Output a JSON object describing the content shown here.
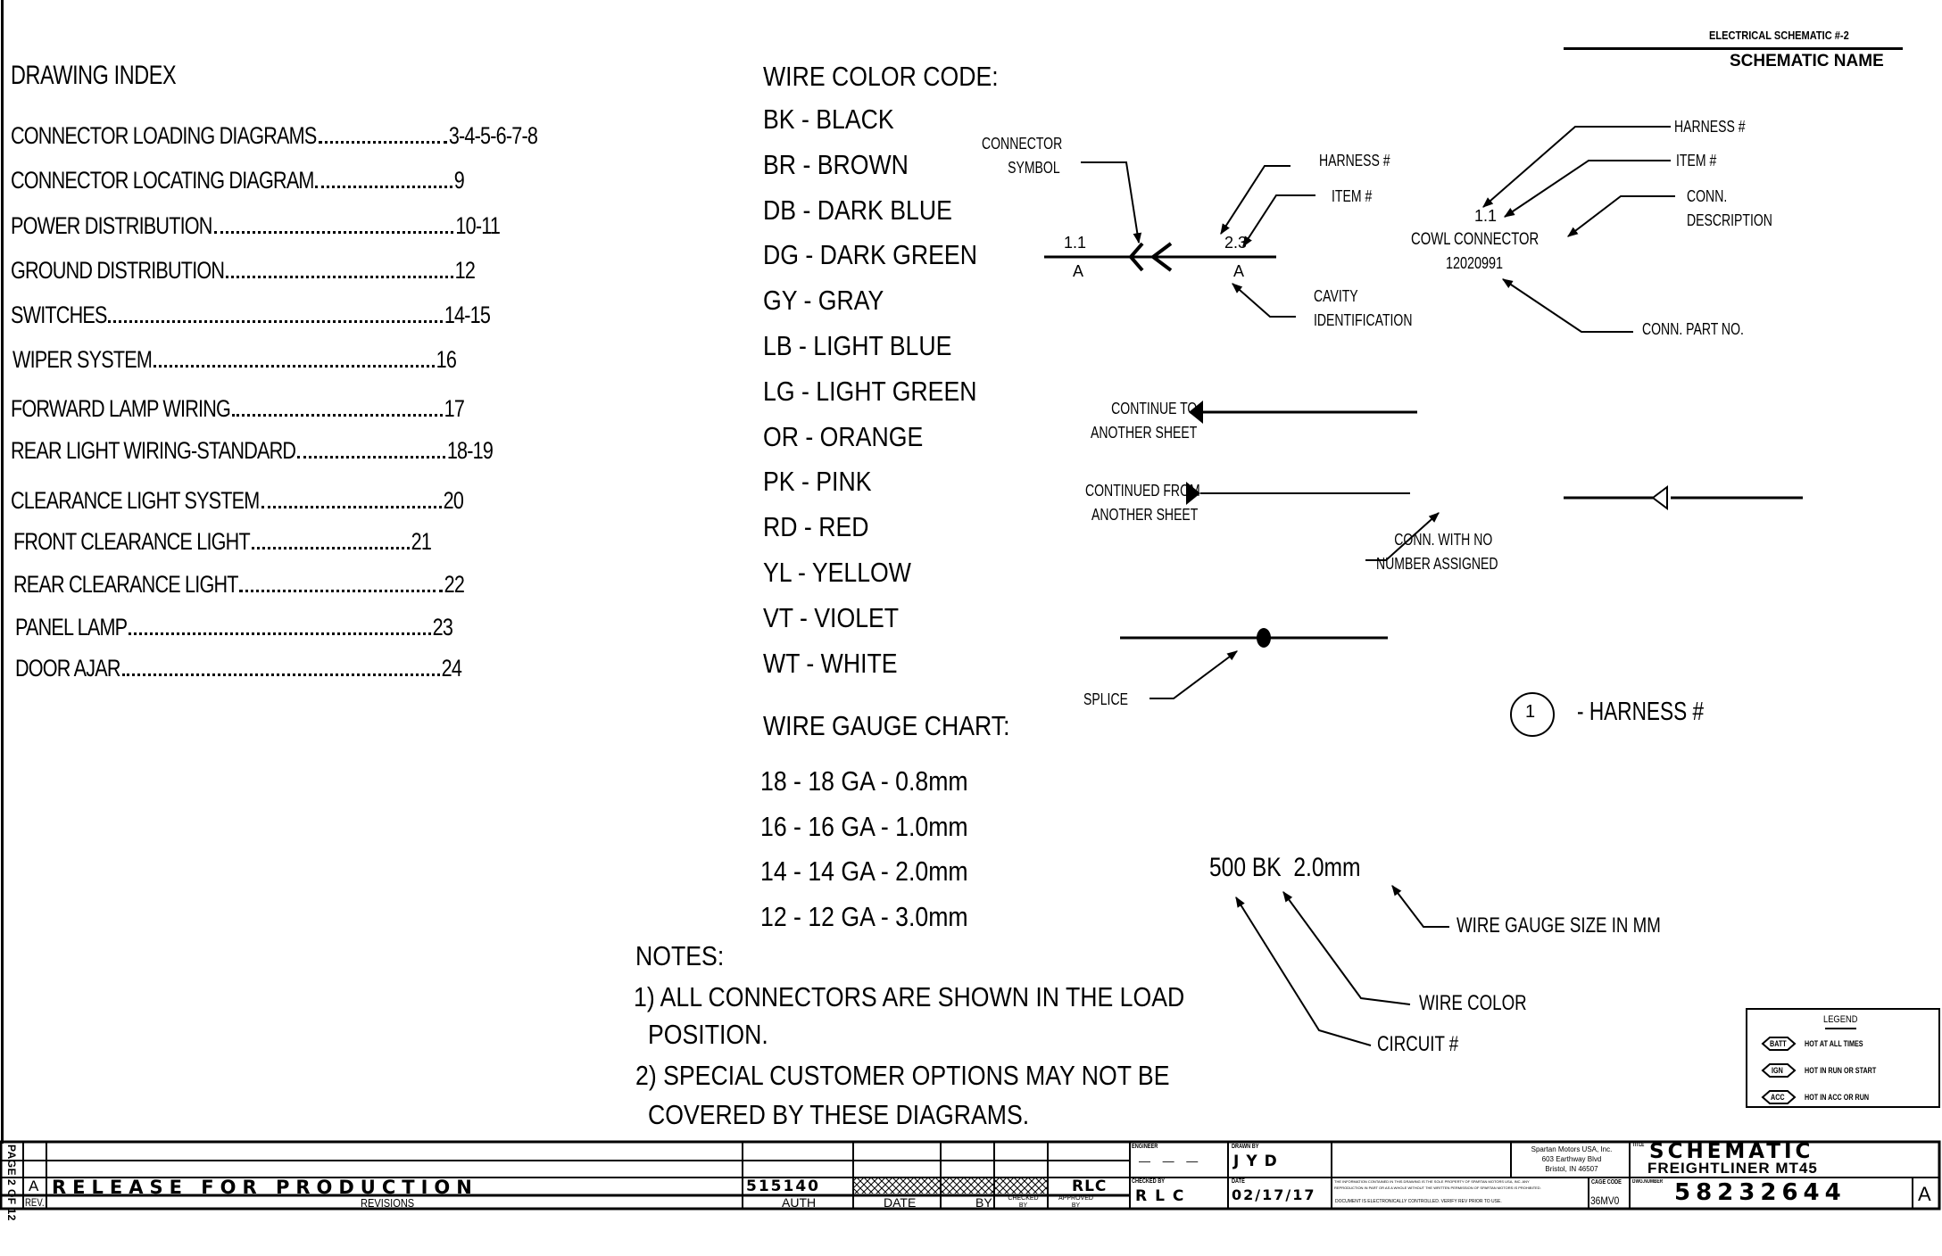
{
  "header": {
    "sheet_label": "ELECTRICAL SCHEMATIC #-2",
    "schematic_name": "SCHEMATIC NAME"
  },
  "drawing_index": {
    "title": "DRAWING INDEX",
    "items": [
      {
        "label": "CONNECTOR LOADING DIAGRAMS",
        "pages": "3-4-5-6-7-8"
      },
      {
        "label": "CONNECTOR LOCATING DIAGRAM",
        "pages": "9"
      },
      {
        "label": "POWER DISTRIBUTION",
        "pages": "10-11"
      },
      {
        "label": "GROUND DISTRIBUTION",
        "pages": "12"
      },
      {
        "label": "SWITCHES",
        "pages": "14-15"
      },
      {
        "label": "WIPER SYSTEM",
        "pages": "16"
      },
      {
        "label": "FORWARD LAMP WIRING",
        "pages": "17"
      },
      {
        "label": "REAR LIGHT WIRING-STANDARD",
        "pages": "18-19"
      },
      {
        "label": "CLEARANCE LIGHT SYSTEM",
        "pages": "20"
      },
      {
        "label": "FRONT CLEARANCE LIGHT",
        "pages": "21"
      },
      {
        "label": "REAR CLEARANCE LIGHT",
        "pages": "22"
      },
      {
        "label": "PANEL LAMP",
        "pages": "23"
      },
      {
        "label": "DOOR AJAR",
        "pages": "24"
      }
    ]
  },
  "wire_color_code": {
    "title": "WIRE COLOR CODE:",
    "items": [
      "BK - BLACK",
      "BR - BROWN",
      "DB - DARK BLUE",
      "DG - DARK GREEN",
      "GY - GRAY",
      "LB - LIGHT BLUE",
      "LG - LIGHT GREEN",
      "OR - ORANGE",
      "PK - PINK",
      "RD - RED",
      "YL - YELLOW",
      "VT - VIOLET",
      "WT - WHITE"
    ]
  },
  "wire_gauge_chart": {
    "title": "WIRE GAUGE CHART:",
    "items": [
      "18 - 18 GA - 0.8mm",
      "16 - 16 GA - 1.0mm",
      "14 - 14 GA - 2.0mm",
      "12 - 12 GA - 3.0mm"
    ]
  },
  "notes": {
    "title": "NOTES:",
    "items": [
      {
        "line1": "1) ALL CONNECTORS ARE SHOWN IN THE LOAD",
        "line2": "POSITION."
      },
      {
        "line1": "2) SPECIAL CUSTOMER OPTIONS MAY NOT BE",
        "line2": "COVERED BY THESE DIAGRAMS."
      }
    ]
  },
  "connector_example": {
    "symbol_label_1": "CONNECTOR",
    "symbol_label_2": "SYMBOL",
    "left_harness_item": "1.1",
    "left_cavity": "A",
    "right_harness_item": "2.3",
    "right_cavity": "A",
    "harness_label": "HARNESS #",
    "item_label": "ITEM #",
    "cavity_label_1": "CAVITY",
    "cavity_label_2": "IDENTIFICATION"
  },
  "cowl_example": {
    "harness_item": "1.1",
    "description": "COWL CONNECTOR",
    "part_no": "12020991",
    "harness_label": "HARNESS #",
    "item_label": "ITEM #",
    "desc_label_1": "CONN.",
    "desc_label_2": "DESCRIPTION",
    "part_label": "CONN. PART NO."
  },
  "symbols": {
    "continue_to_1": "CONTINUE TO",
    "continue_to_2": "ANOTHER SHEET",
    "continued_from_1": "CONTINUED FROM",
    "continued_from_2": "ANOTHER SHEET",
    "no_number_1": "CONN. WITH NO",
    "no_number_2": "NUMBER ASSIGNED",
    "splice": "SPLICE",
    "harness_circle_number": "1",
    "harness_circle_label": "- HARNESS #"
  },
  "wire_label_example": {
    "text": "500 BK  2.0mm",
    "gauge_label": "WIRE GAUGE SIZE IN MM",
    "color_label": "WIRE COLOR",
    "circuit_label": "CIRCUIT #"
  },
  "legend": {
    "title": "LEGEND",
    "items": [
      {
        "tag": "BATT",
        "desc": "HOT AT ALL TIMES"
      },
      {
        "tag": "IGN",
        "desc": "HOT IN RUN OR START"
      },
      {
        "tag": "ACC",
        "desc": "HOT IN ACC OR RUN"
      }
    ]
  },
  "title_block": {
    "page": "PAGE 2 OF 12",
    "rev_letter": "A",
    "revision_text": "RELEASE FOR PRODUCTION",
    "rev_header": "REV.",
    "revisions_header": "REVISIONS",
    "auth_value": "515140",
    "auth_header": "AUTH",
    "date_header": "DATE",
    "by_header": "BY",
    "checked_header": "CHECKED BY",
    "approved_value": "RLC",
    "approved_header": "APPROVED BY",
    "engineer_label": "ENGINEER",
    "engineer_value": "— — —",
    "checked_by_label": "CHECKED BY",
    "checked_by_value": "RLC",
    "drawn_by_label": "DRAWN BY",
    "drawn_by_value": "JYD",
    "date_label": "DATE",
    "date_value": "02/17/17",
    "proprietary_text_1": "THE INFORMATION CONTAINED IN THIS DRAWING IS THE SOLE PROPERTY OF SPARTAN MOTORS USA, INC. ANY",
    "proprietary_text_2": "REPRODUCTION IN PART OR AS A WHOLE WITHOUT THE WRITTEN PERMISSION OF SPARTAN MOTORS IS PROHIBITED.",
    "controlled_text": "DOCUMENT IS ELECTRONICALLY CONTROLLED. VERIFY REV PRIOR TO USE.",
    "company_1": "Spartan Motors USA, Inc.",
    "company_2": "603 Earthway Blvd",
    "company_3": "Bristol,  IN  46507",
    "cage_label": "CAGE CODE",
    "cage_value": "36MV0",
    "title_label": "TITLE",
    "title_1": "SCHEMATIC",
    "title_2": "FREIGHTLINER MT45",
    "dwg_label": "DWG.NUMBER",
    "dwg_number": "58232644",
    "dwg_rev": "A"
  }
}
